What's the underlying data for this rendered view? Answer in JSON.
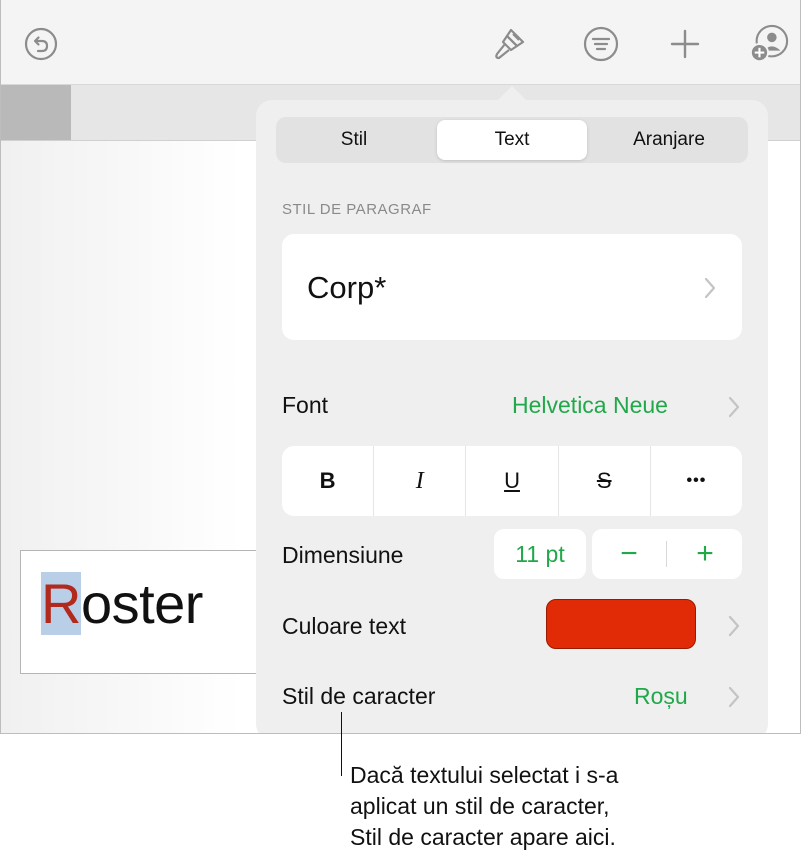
{
  "toolbar": {
    "icons": [
      "undo-icon",
      "paintbrush-icon",
      "text-list-icon",
      "plus-icon",
      "collaborate-icon"
    ]
  },
  "document": {
    "roster_first": "R",
    "roster_rest": "oster"
  },
  "popover": {
    "tabs": [
      "Stil",
      "Text",
      "Aranjare"
    ],
    "active_tab": "Text",
    "paragraph_section_label": "STIL DE PARAGRAF",
    "paragraph_style": "Corp*",
    "font_label": "Font",
    "font_value": "Helvetica Neue",
    "format_buttons": [
      "B",
      "I",
      "U",
      "S",
      "•••"
    ],
    "size_label": "Dimensiune",
    "size_value": "11 pt",
    "minus": "−",
    "plus": "+",
    "color_label": "Culoare text",
    "color_value": "#e12a06",
    "char_style_label": "Stil de caracter",
    "char_style_value": "Roșu"
  },
  "callout": {
    "line1": "Dacă textului selectat i s-a",
    "line2": "aplicat un stil de caracter,",
    "line3": "Stil de caracter apare aici."
  },
  "colors": {
    "accent_green": "#21a84a",
    "selection_blue": "#b9cfe8",
    "roster_red": "#b2291e"
  }
}
